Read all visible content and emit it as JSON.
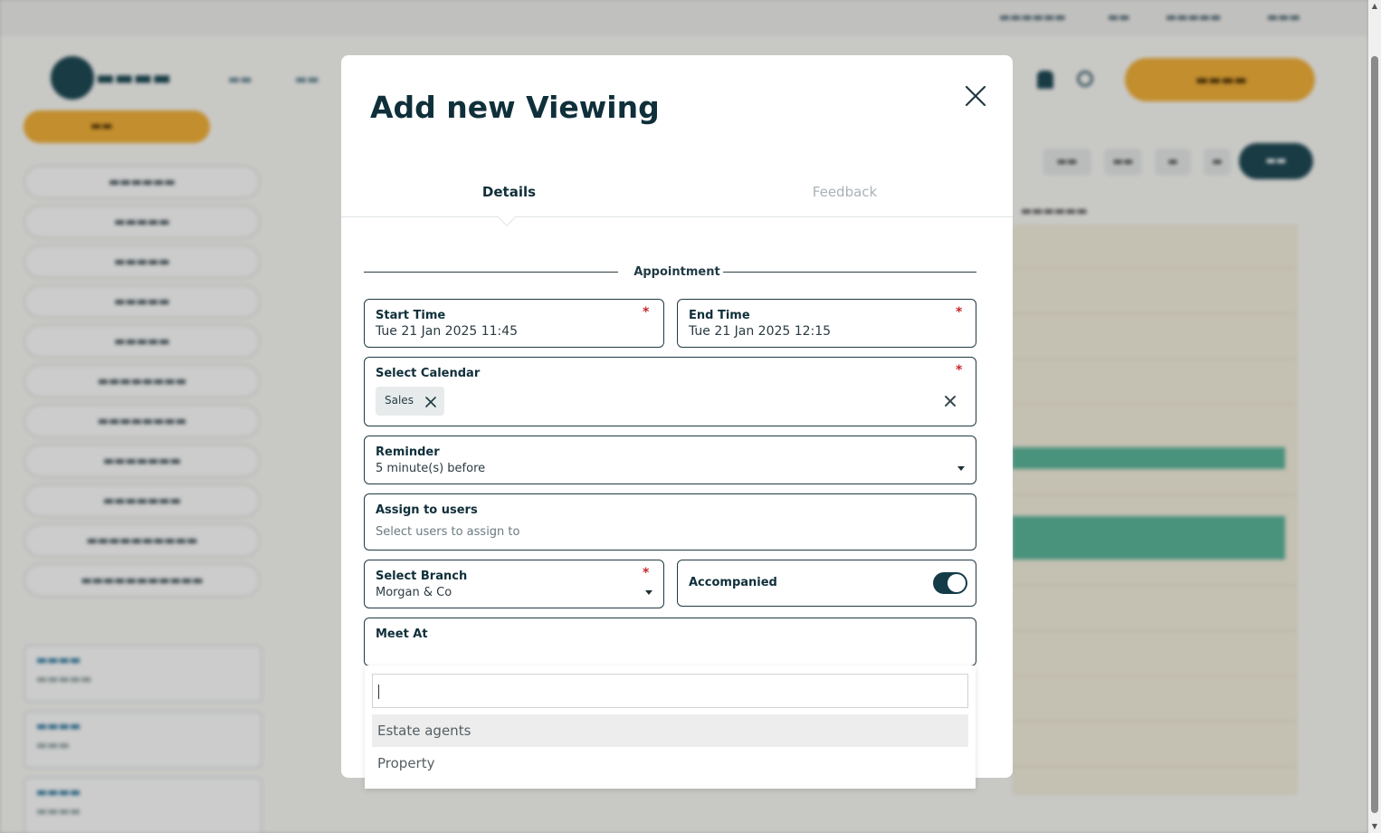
{
  "modal": {
    "title": "Add new Viewing",
    "tabs": [
      {
        "label": "Details",
        "active": true
      },
      {
        "label": "Feedback",
        "active": false
      }
    ],
    "section_label": "Appointment",
    "fields": {
      "start_time": {
        "label": "Start Time",
        "value": "Tue 21 Jan 2025 11:45",
        "required_mark": "*"
      },
      "end_time": {
        "label": "End Time",
        "value": "Tue 21 Jan 2025 12:15",
        "required_mark": "*"
      },
      "calendar": {
        "label": "Select Calendar",
        "chip": "Sales",
        "required_mark": "*"
      },
      "reminder": {
        "label": "Reminder",
        "value": "5 minute(s) before"
      },
      "assign": {
        "label": "Assign to users",
        "placeholder": "Select users to assign to"
      },
      "branch": {
        "label": "Select Branch",
        "value": "Morgan & Co",
        "required_mark": "*"
      },
      "accompanied": {
        "label": "Accompanied",
        "on": true
      },
      "meet_at": {
        "label": "Meet At"
      }
    },
    "meet_at_dropdown": {
      "search_value": "",
      "options": [
        "Estate agents",
        "Property"
      ],
      "highlighted": "Estate agents"
    }
  },
  "colors": {
    "primary_dark": "#0f2f3a",
    "accent_orange": "#f3b23a",
    "required_red": "#c8282d",
    "toggle_on": "#143c48",
    "calendar_event": "#5cb79b"
  },
  "icons": {
    "close": "close-icon",
    "chip_remove": "x-icon",
    "clear": "clear-icon",
    "caret": "caret-down-icon"
  }
}
